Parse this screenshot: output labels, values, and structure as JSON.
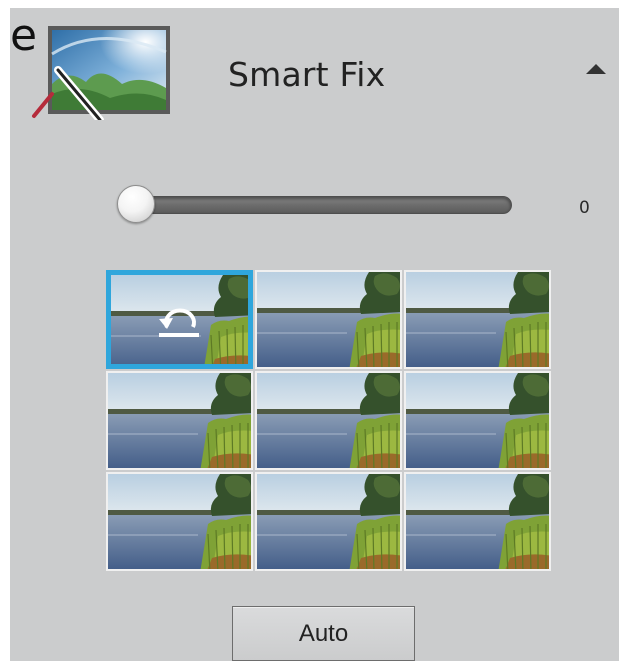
{
  "panel": {
    "cut_letter": "e",
    "title": "Smart Fix",
    "icon": "smart-fix-icon",
    "collapse_icon": "triangle-up-icon"
  },
  "slider": {
    "value": 0,
    "value_label": "0",
    "min": 0,
    "max": 100
  },
  "thumbnails": {
    "count": 9,
    "selected_index": 0,
    "selected_icon": "reset-icon"
  },
  "auto_button": {
    "label": "Auto"
  },
  "colors": {
    "panel_bg": "#cbcccd",
    "selection": "#2fa6dc"
  }
}
